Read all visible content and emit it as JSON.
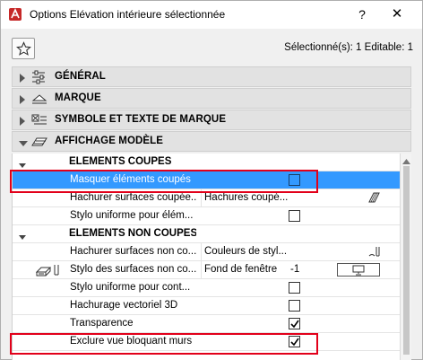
{
  "window": {
    "title": "Options Elévation intérieure sélectionnée",
    "help_label": "?",
    "close_label": "✕"
  },
  "selection_info": "Sélectionné(s): 1 Editable: 1",
  "panels": [
    {
      "label": "GÉNÉRAL",
      "icon": "general-settings-icon",
      "expanded": false
    },
    {
      "label": "MARQUE",
      "icon": "marker-icon",
      "expanded": false
    },
    {
      "label": "SYMBOLE ET TEXTE DE MARQUE",
      "icon": "symbol-text-icon",
      "expanded": false
    },
    {
      "label": "AFFICHAGE MODÈLE",
      "icon": "model-display-icon",
      "expanded": true
    }
  ],
  "properties": {
    "group_cut": "ELÉMENTS COUPÉS",
    "hide_cut": {
      "name": "Masquer éléments coupés",
      "checked": false
    },
    "hatch_cut": {
      "name": "Hachurer surfaces coupée...",
      "value": "Hachures coupé..."
    },
    "uniform_pen_cut": {
      "name": "Stylo uniforme pour élém...",
      "checked": false
    },
    "group_uncut": "ELÉMENTS NON COUPÉS",
    "hatch_uncut": {
      "name": "Hachurer surfaces non co...",
      "value": "Couleurs de styl..."
    },
    "pen_surfaces": {
      "name": "Stylo des surfaces non co...",
      "value": "Fond de fenêtre",
      "pen_number": "-1"
    },
    "uniform_pen_uncut": {
      "name": "Stylo uniforme pour cont...",
      "checked": false
    },
    "vector_hatch": {
      "name": "Hachurage vectoriel 3D",
      "checked": false
    },
    "transparency": {
      "name": "Transparence",
      "checked": true
    },
    "exclude_blocking": {
      "name": "Exclure vue bloquant murs",
      "checked": true
    }
  },
  "colors": {
    "selection": "#3399ff",
    "highlight": "#e2001a",
    "panel_header": "#e2e2e2"
  }
}
